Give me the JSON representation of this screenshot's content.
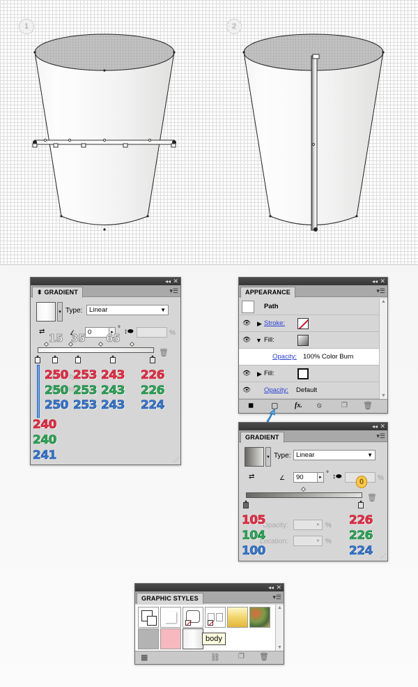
{
  "steps": [
    "1",
    "2"
  ],
  "gradient_panel_1": {
    "tab": "GRADIENT",
    "type_label": "Type:",
    "type_value": "Linear",
    "angle_value": "0",
    "degree_symbol": "°",
    "percent_symbol": "%",
    "location_labels": [
      "15",
      "35",
      "65"
    ],
    "faded_labels": {
      "opacity": "Opacity:",
      "location": "Location:"
    },
    "red_values": [
      "250",
      "253",
      "243",
      "226"
    ],
    "green_values": [
      "250",
      "253",
      "243",
      "226"
    ],
    "blue_values": [
      "250",
      "253",
      "243",
      "224"
    ],
    "first_stop": {
      "r": "240",
      "g": "240",
      "b": "241"
    }
  },
  "appearance_panel": {
    "tab": "APPEARANCE",
    "title": "Path",
    "rows": [
      {
        "label": "Stroke:",
        "link": true
      },
      {
        "label": "Fill:",
        "link": false
      },
      {
        "label": "Opacity:",
        "value": "100% Color Burn",
        "link": true
      },
      {
        "label": "Fill:",
        "link": false
      },
      {
        "label": "Opacity:",
        "value": "Default",
        "link": true
      }
    ],
    "footer_icons": [
      "new-art-basic-icon",
      "add-new-stroke-icon",
      "fx-icon",
      "clear-icon",
      "duplicate-icon",
      "delete-icon"
    ],
    "fx_label": "fx."
  },
  "gradient_panel_2": {
    "tab": "GRADIENT",
    "type_label": "Type:",
    "type_value": "Linear",
    "angle_value": "90",
    "degree_symbol": "°",
    "percent_symbol": "%",
    "aspect_marker": "0",
    "opacity_label": "Opacity:",
    "location_label": "Location:",
    "left_stop": {
      "r": "105",
      "g": "104",
      "b": "100"
    },
    "right_stop": {
      "r": "226",
      "g": "226",
      "b": "224"
    }
  },
  "graphic_styles_panel": {
    "tab": "GRAPHIC STYLES",
    "tooltip": "body",
    "swatch_colors": [
      "#ffffff",
      "#ffffff",
      "#ffffff",
      "#ffffff",
      "#f2d56a",
      "#7a9a4a",
      "#b3b3b3",
      "#f7b8c0",
      "#e8e8e8"
    ]
  },
  "colors": {
    "red": "#e8344a",
    "green": "#2ea85a",
    "blue": "#3a7ad0",
    "panel_bg": "#d6d6d6",
    "titlebar": "#3d3d3d"
  }
}
